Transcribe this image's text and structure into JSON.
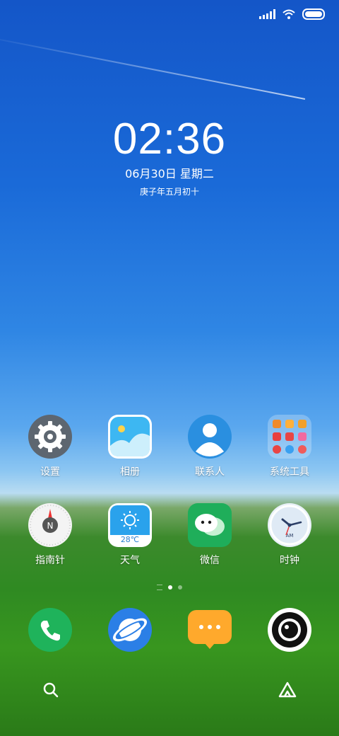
{
  "status_bar": {
    "signal_icon": "signal-icon",
    "wifi_icon": "wifi-icon",
    "battery_icon": "battery-icon"
  },
  "clock": {
    "time": "02:36",
    "date": "06月30日 星期二",
    "lunar": "庚子年五月初十"
  },
  "apps_row1": [
    {
      "label": "设置",
      "icon": "settings-icon"
    },
    {
      "label": "相册",
      "icon": "gallery-icon"
    },
    {
      "label": "联系人",
      "icon": "contacts-icon"
    },
    {
      "label": "系统工具",
      "icon": "folder-icon"
    }
  ],
  "apps_row2": [
    {
      "label": "指南针",
      "icon": "compass-icon"
    },
    {
      "label": "天气",
      "icon": "weather-icon",
      "temp": "28℃"
    },
    {
      "label": "微信",
      "icon": "wechat-icon"
    },
    {
      "label": "时钟",
      "icon": "clock-icon",
      "am": "AM"
    }
  ],
  "dock": [
    {
      "icon": "phone-icon"
    },
    {
      "icon": "browser-icon"
    },
    {
      "icon": "messages-icon"
    },
    {
      "icon": "camera-icon"
    }
  ],
  "bottom": {
    "search_icon": "search-icon",
    "assistant_icon": "assistant-icon"
  },
  "colors": {
    "phone": "#1fb35b",
    "browser": "#2b7fe6",
    "messages": "#ffa92c",
    "wechat": "#1fae5a"
  }
}
